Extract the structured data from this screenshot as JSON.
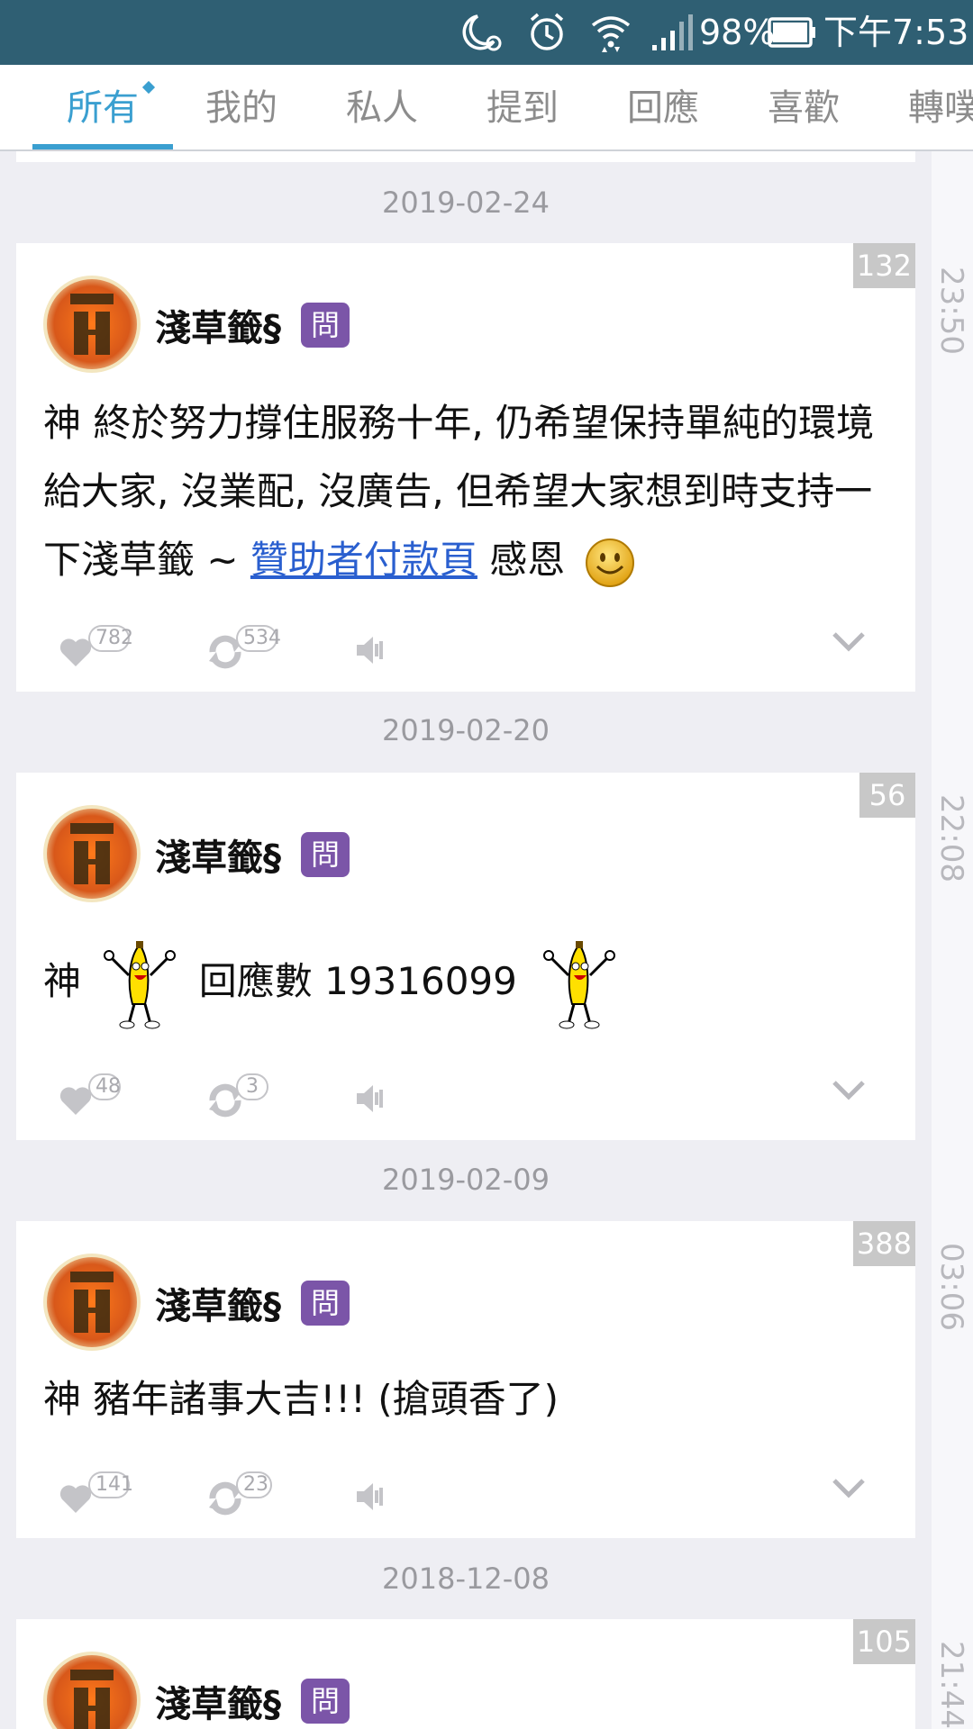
{
  "status_bar": {
    "battery": "98%",
    "time": "下午7:53",
    "icons": [
      "do-not-disturb-moon-icon",
      "alarm-icon",
      "wifi-icon",
      "signal-icon",
      "battery-icon"
    ]
  },
  "tabs": [
    {
      "label": "所有",
      "active": true
    },
    {
      "label": "我的",
      "active": false
    },
    {
      "label": "私人",
      "active": false
    },
    {
      "label": "提到",
      "active": false
    },
    {
      "label": "回應",
      "active": false
    },
    {
      "label": "喜歡",
      "active": false
    },
    {
      "label": "轉噗",
      "active": false
    }
  ],
  "posts": [
    {
      "date": "2019-02-24",
      "time": "23:50",
      "count": "132",
      "username": "淺草籤§",
      "role": "問",
      "verb": "神",
      "text_before_link": "終於努力撐住服務十年, 仍希望保持單純的環境給大家, 沒業配, 沒廣告, 但希望大家想到時支持一下淺草籤 ~ ",
      "link_text": "贊助者付款頁",
      "text_after_link": " 感恩",
      "likes": "782",
      "replurks": "534"
    },
    {
      "date": "2019-02-20",
      "time": "22:08",
      "count": "56",
      "username": "淺草籤§",
      "role": "問",
      "verb": "神",
      "text": "回應數 19316099",
      "likes": "48",
      "replurks": "3"
    },
    {
      "date": "2019-02-09",
      "time": "03:06",
      "count": "388",
      "username": "淺草籤§",
      "role": "問",
      "verb": "神",
      "text": "豬年諸事大吉!!! (搶頭香了)",
      "likes": "141",
      "replurks": "23"
    },
    {
      "date": "2018-12-08",
      "time": "21:44",
      "count": "105",
      "username": "淺草籤§",
      "role": "問"
    }
  ],
  "colors": {
    "status_bar": "#2f5f73",
    "tab_active": "#3a9fd0",
    "tab_inactive": "#8c8c8c",
    "role_badge": "#7b55a8",
    "link": "#2a5fcf",
    "background": "#eeeef3"
  }
}
